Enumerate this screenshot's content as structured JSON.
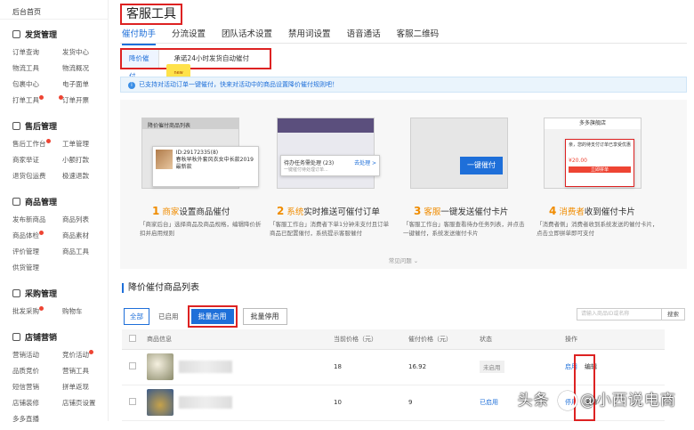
{
  "sidebar": {
    "home": "后台首页",
    "sections": [
      {
        "title": "发货管理",
        "items": [
          "订单查询",
          "发货中心",
          "物流工具",
          "物流概况",
          "包裹中心",
          "电子面单",
          "打单工具",
          "订单开票"
        ]
      },
      {
        "title": "售后管理",
        "items": [
          "售后工作台",
          "工单管理",
          "商家举证",
          "小额打款",
          "退货包运费",
          "极速退款"
        ]
      },
      {
        "title": "商品管理",
        "items": [
          "发布新商品",
          "商品列表",
          "商品体检",
          "商品素材",
          "评价管理",
          "商品工具",
          "供货管理"
        ]
      },
      {
        "title": "采购管理",
        "items": [
          "批发采购",
          "购物车"
        ]
      },
      {
        "title": "店铺营销",
        "items": [
          "营销活动",
          "竞价活动",
          "品质竞价",
          "营销工具",
          "短信营销",
          "拼单返现",
          "店铺装修",
          "店铺页设置"
        ]
      }
    ],
    "cut_text": "多多直播"
  },
  "header": {
    "title": "客服工具",
    "tabs": [
      "催付助手",
      "分流设置",
      "团队话术设置",
      "禁用词设置",
      "语音通话",
      "客服二维码"
    ],
    "active_tab": 0
  },
  "subtabs": {
    "items": [
      "降价催付",
      "承诺24小时发货自动催付"
    ],
    "new_badge": "new"
  },
  "notice": "已支持对活动订单一键催付，快来对活动中的商品设置降价催付规则吧！",
  "steps": [
    {
      "num": "1",
      "role": "商家",
      "title": "设置商品催付",
      "desc": "「商家后台」选择商品及商品规格，编辑降价折扣并启用规则",
      "panel_title": "降价催付商品列表",
      "panel_text": "春秋早秋外套风衣女中长款2019最新款",
      "panel_id": "ID:29172335(8)"
    },
    {
      "num": "2",
      "role": "系统",
      "title": "实时推送可催付订单",
      "desc": "「客服工作台」消费者下单1分钟未支付且订单商品已配置催付，系统提示客服催付",
      "panel_title": "待办任务需处理 (23)",
      "panel_sub": "一键催付待处理订单...",
      "panel_action": "去处理 >"
    },
    {
      "num": "3",
      "role": "客服",
      "title": "一键发送催付卡片",
      "desc": "「客服工作台」客服查看待办任务列表，并点击一键催付，系统发送催付卡片",
      "button": "一键催付"
    },
    {
      "num": "4",
      "role": "消费者",
      "title": "收到催付卡片",
      "desc": "「消费者侧」消费者收到系统发送的催付卡片，点击立即拼单即可支付",
      "panel_title": "多多旗舰店",
      "panel_text": "亲，您的待支付订单已享受优惠",
      "panel_price": "¥20.00",
      "panel_button": "立即拼单"
    }
  ],
  "faq": "常见问题",
  "list": {
    "title": "降价催付商品列表",
    "filters": [
      "全部",
      "已启用"
    ],
    "batch_enable": "批量启用",
    "batch_disable": "批量停用",
    "search_placeholder": "请输入商品ID或名称",
    "search_button": "搜索",
    "columns": [
      "",
      "商品信息",
      "当前价格（元）",
      "催付价格（元）",
      "状态",
      "操作"
    ],
    "rows": [
      {
        "current": "18",
        "urge": "16.92",
        "status": "未启用",
        "op": "启用",
        "op2": "编辑"
      },
      {
        "current": "10",
        "urge": "9",
        "status": "已启用",
        "op": "停用",
        "op2": "编辑"
      }
    ]
  },
  "watermark": {
    "left": "头条",
    "mid": "@",
    "right": "小西说电商"
  },
  "colors": {
    "accent": "#1e6fd9",
    "highlight": "#d22222",
    "orange": "#f08c00"
  }
}
